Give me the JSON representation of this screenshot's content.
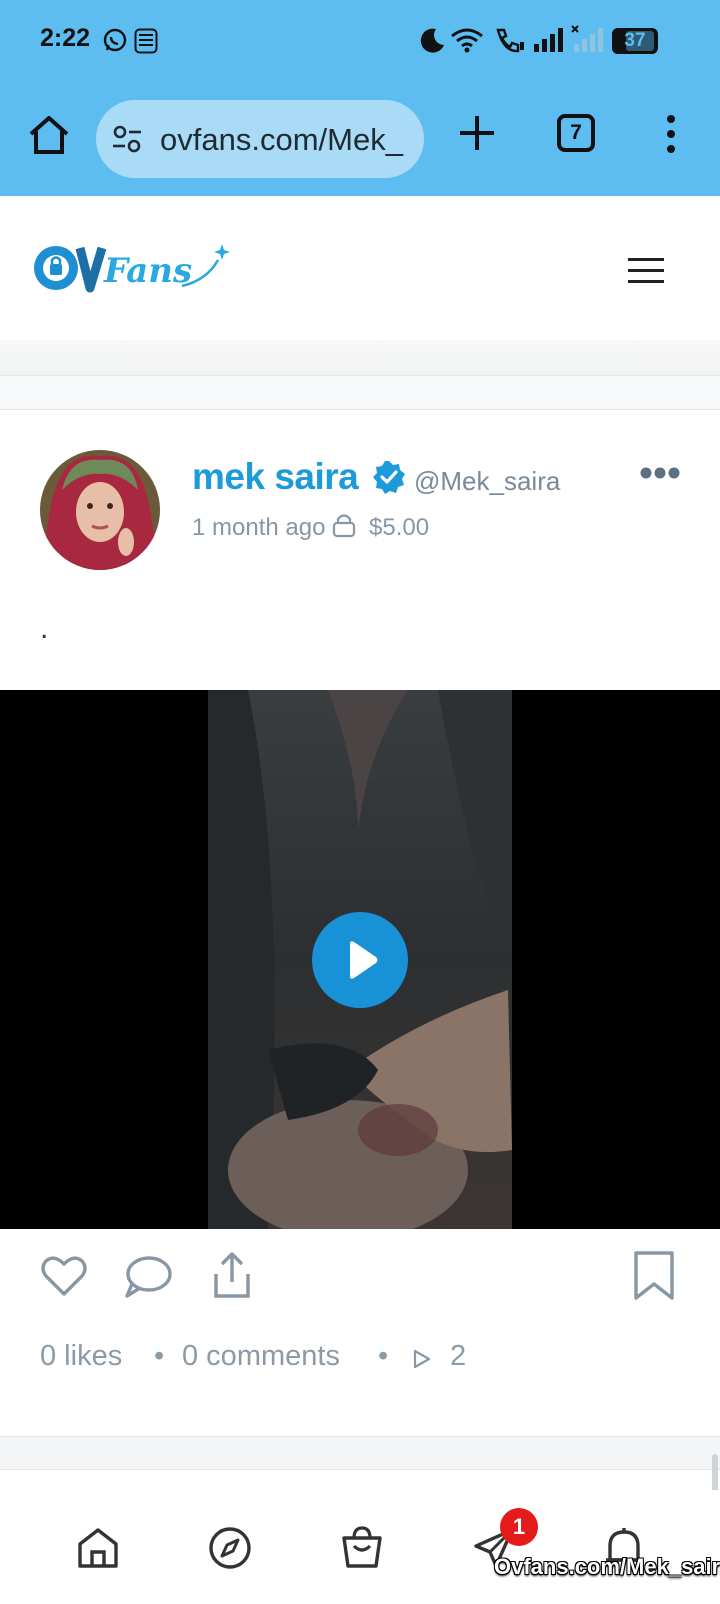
{
  "status_bar": {
    "time": "2:22",
    "battery": "37",
    "icons": [
      "whatsapp-icon",
      "touch-n-go-icon",
      "do-not-disturb-moon-icon",
      "wifi-icon",
      "wifi-calling-icon",
      "signal-icon",
      "signal-no-service-icon",
      "battery-icon"
    ]
  },
  "browser": {
    "url": "ovfans.com/Mek_",
    "tab_count": "7"
  },
  "site": {
    "logo_text": "OVFans"
  },
  "post": {
    "author_name": "mek saira",
    "handle": "@Mek_saira",
    "time_ago": "1 month ago",
    "price": "$5.00",
    "caption": ".",
    "likes": "0 likes",
    "comments": "0 comments",
    "views": "2",
    "separator": "•"
  },
  "bottom_nav": {
    "items": [
      "home",
      "explore",
      "shop",
      "messages",
      "notifications"
    ],
    "messages_badge": "1",
    "watermark": "Ovfans.com/Mek_saira"
  },
  "colors": {
    "status_bar_bg": "#5ebdf0",
    "accent": "#1c9ad9",
    "play_button": "#1991d6",
    "badge": "#e31b1b"
  }
}
